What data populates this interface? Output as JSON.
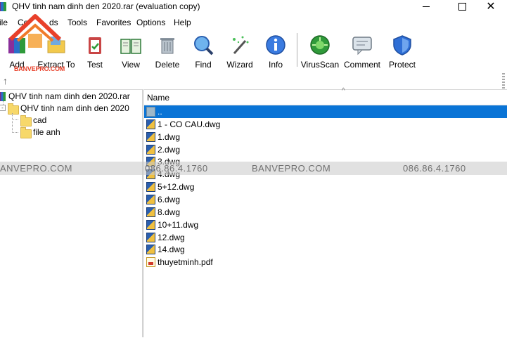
{
  "window": {
    "title": "QHV tinh nam dinh den 2020.rar (evaluation copy)",
    "minimize_glyph": "",
    "maximize_glyph": "",
    "close_glyph": "✕"
  },
  "menu": {
    "file": "ile",
    "commands": "Co",
    "commands_tail": "ds",
    "tools": "Tools",
    "favorites": "Favorites",
    "options": "Options",
    "help": "Help"
  },
  "toolbar": {
    "add": "Add",
    "extract": "Extract To",
    "test": "Test",
    "view": "View",
    "delete": "Delete",
    "find": "Find",
    "wizard": "Wizard",
    "info": "Info",
    "virusscan": "VirusScan",
    "comment": "Comment",
    "protect": "Protect"
  },
  "logo": {
    "text": "BANVEPRO.COM",
    "icon": "house-logo-icon"
  },
  "address": {
    "up_glyph": "↑",
    "icon": "up-arrow-icon"
  },
  "tree": {
    "root": "QHV tinh nam dinh den 2020.rar",
    "folder": "QHV tinh nam dinh den 2020",
    "children": [
      "cad",
      "file anh"
    ]
  },
  "list": {
    "column_name": "Name",
    "sort_glyph": "^",
    "rows": [
      {
        "name": "..",
        "type": "up"
      },
      {
        "name": "1 - CO CAU.dwg",
        "type": "dwg"
      },
      {
        "name": "1.dwg",
        "type": "dwg"
      },
      {
        "name": "2.dwg",
        "type": "dwg"
      },
      {
        "name": "3.dwg",
        "type": "dwg"
      },
      {
        "name": "4.dwg",
        "type": "dwg"
      },
      {
        "name": "5+12.dwg",
        "type": "dwg"
      },
      {
        "name": "6.dwg",
        "type": "dwg"
      },
      {
        "name": "8.dwg",
        "type": "dwg"
      },
      {
        "name": "10+11.dwg",
        "type": "dwg"
      },
      {
        "name": "12.dwg",
        "type": "dwg"
      },
      {
        "name": "14.dwg",
        "type": "dwg"
      },
      {
        "name": "thuyetminh.pdf",
        "type": "pdf"
      }
    ],
    "selected_index": 0
  },
  "watermark": {
    "a": "ANVEPRO.COM",
    "b": "086.86.4.1760",
    "c": "BANVEPRO.COM",
    "d": "086.86.4.1760"
  },
  "colors": {
    "selection": "#0a74d6",
    "accent_logo": "#e8402a"
  }
}
